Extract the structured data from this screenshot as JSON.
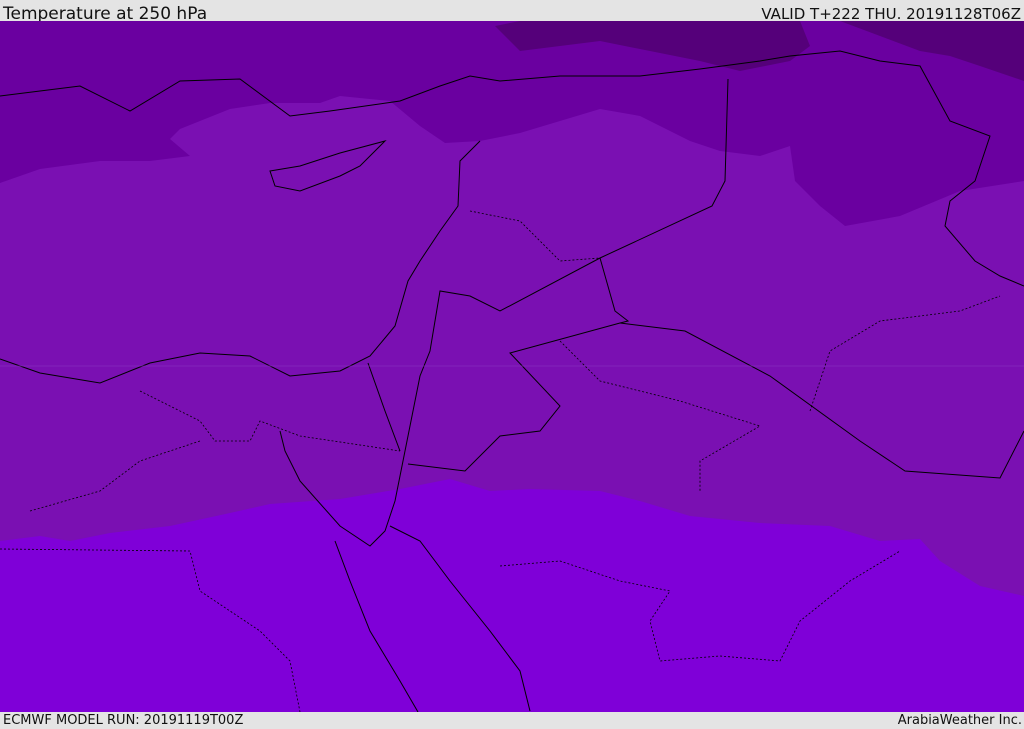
{
  "header": {
    "title": "Temperature at 250 hPa",
    "valid": "VALID T+222 THU. 20191128T06Z"
  },
  "footer": {
    "model_run": "ECMWF MODEL RUN: 20191119T00Z",
    "credit": "ArabiaWeather Inc."
  },
  "map": {
    "variable": "temperature",
    "level_hpa": 250,
    "colors": {
      "coldest": "#55007a",
      "cold": "#6a00a0",
      "mid": "#7a10b2",
      "warm": "#7f00d8",
      "coast": "#000000"
    }
  }
}
